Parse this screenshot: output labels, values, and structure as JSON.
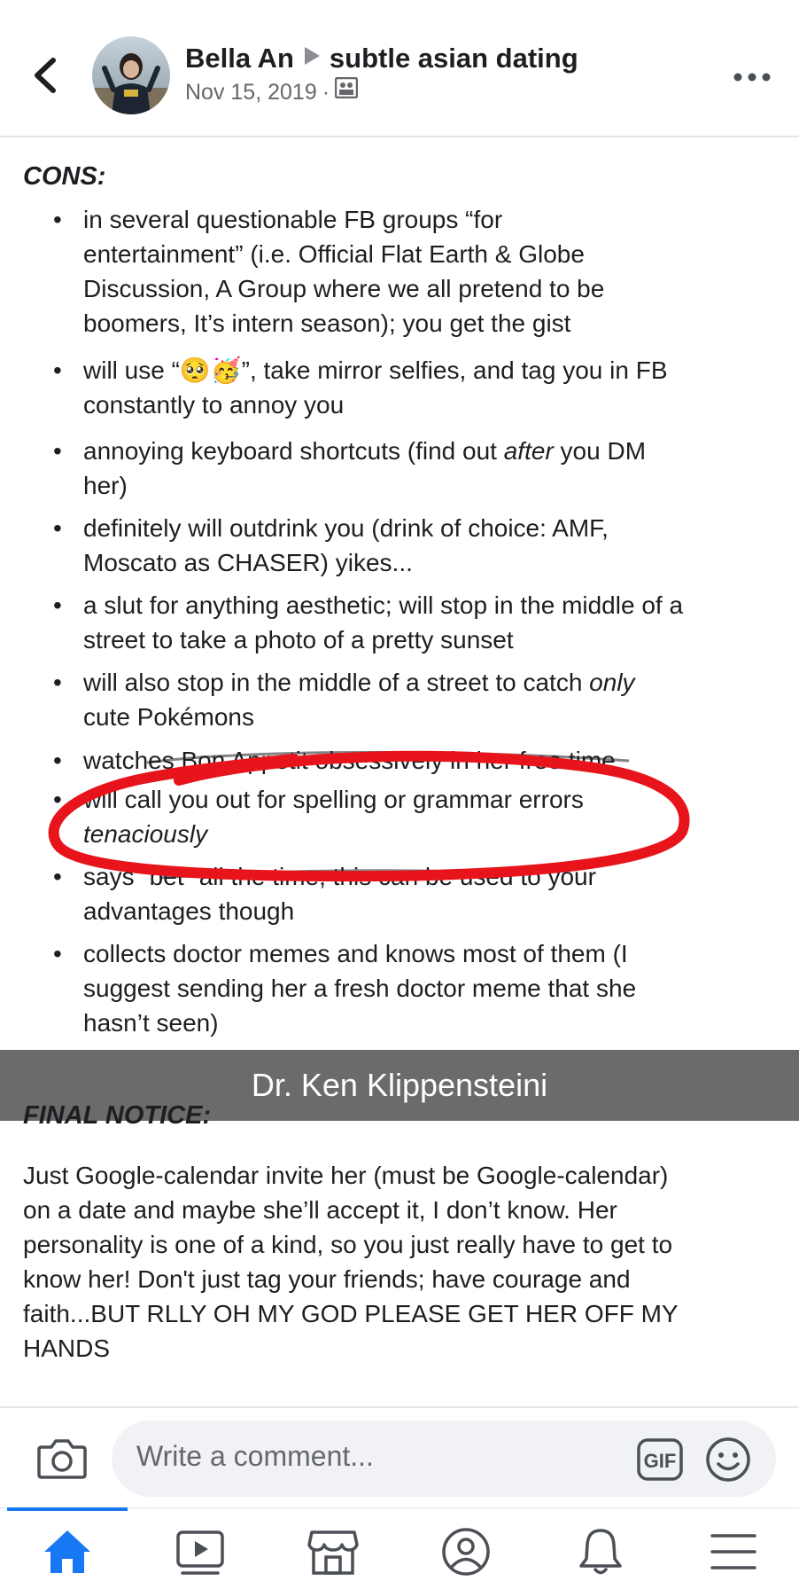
{
  "header": {
    "author": "Bella An",
    "group": "subtle asian dating",
    "date": "Nov 15, 2019",
    "separator": "·"
  },
  "post": {
    "cons_heading": "CONS:",
    "cons": [
      "in several questionable FB groups “for entertainment” (i.e. Official Flat Earth & Globe Discussion, A Group where we all pretend to be boomers, It’s intern season); you get the gist",
      "will use “🥺🥳”, take mirror selfies, and tag you in FB constantly to annoy you",
      "annoying keyboard shortcuts (find out after you DM her)",
      "definitely will outdrink you (drink of choice: AMF, Moscato as CHASER) yikes...",
      "a slut for anything aesthetic; will stop in the middle of a street to take a photo of a pretty sunset",
      "will also stop in the middle of a street to catch only cute Pokémons",
      "watches Bon Appetit obsessively in her free time",
      "will call you out for spelling or grammar errors tenaciously",
      "says “bet” all the time; this can be used to your advantages though",
      "collects doctor memes and knows most of them (I suggest sending her a fresh doctor meme that she hasn’t seen)"
    ],
    "cons_lines": [
      [
        "in several questionable FB groups “for",
        "entertainment” (i.e. Official Flat Earth & Globe",
        "Discussion, A Group where we all pretend to be",
        "boomers, It’s intern season); you get the gist"
      ],
      [
        "will use “🥺🥳”, take mirror selfies, and tag you in FB",
        "constantly to annoy you"
      ],
      [
        "annoying keyboard shortcuts (find out after you DM",
        "her)"
      ],
      [
        "definitely will outdrink you (drink of choice: AMF,",
        "Moscato as CHASER) yikes..."
      ],
      [
        "a slut for anything aesthetic; will stop in the middle of a",
        "street to take a photo of a pretty sunset"
      ],
      [
        "will also stop in the middle of a street to catch only",
        "cute Pokémons"
      ],
      [
        "watches Bon Appetit obsessively in her free time"
      ],
      [
        "will call you out for spelling or grammar errors",
        "tenaciously"
      ],
      [
        "says “bet” all the time; this can be used to your",
        "advantages though"
      ],
      [
        "collects doctor memes and knows most of them (I",
        "suggest sending her a fresh doctor meme that she",
        "hasn’t seen)"
      ]
    ],
    "final_heading": "FINAL NOTICE:",
    "final_lines": [
      "Just Google-calendar invite her (must be Google-calendar)",
      "on a date and maybe she’ll accept it, I don’t know. Her",
      "personality is one of a kind, so you just really have to get to",
      "know her! Don't just tag your friends; have courage and",
      "faith...BUT RLLY OH MY GOD PLEASE GET HER OFF MY",
      "HANDS"
    ],
    "annotation_color": "#e8141b"
  },
  "banner": {
    "text": "Dr. Ken Klippensteini"
  },
  "comment": {
    "placeholder": "Write a comment...",
    "gif_label": "GIF"
  },
  "nav": {
    "active": "home",
    "items": [
      "home-icon",
      "watch-icon",
      "marketplace-icon",
      "profile-icon",
      "notifications-icon",
      "menu-icon"
    ],
    "accent": "#1877f2"
  }
}
